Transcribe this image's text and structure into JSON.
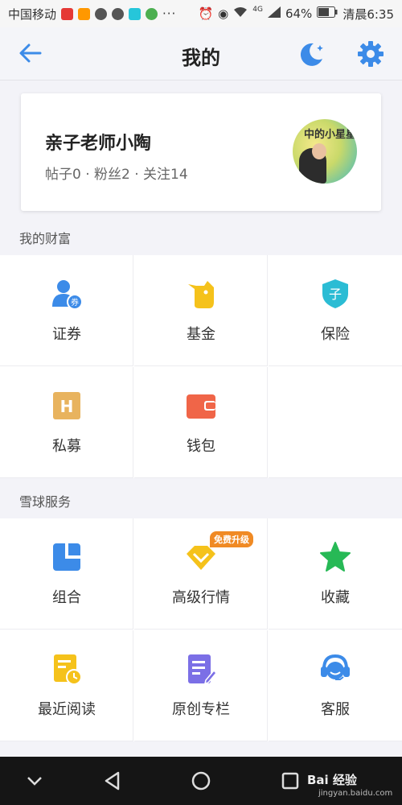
{
  "status_bar": {
    "carrier": "中国移动",
    "battery": "64%",
    "time": "清晨6:35",
    "dots": "···",
    "signal_label": "4G"
  },
  "header": {
    "title": "我的"
  },
  "profile": {
    "name": "亲子老师小陶",
    "stats": "帖子0 · 粉丝2 · 关注14",
    "avatar_text": "中的小星星"
  },
  "wealth": {
    "title": "我的财富",
    "items": [
      {
        "label": "证券",
        "icon": "user-coupon-icon",
        "badge_glyph": "券"
      },
      {
        "label": "基金",
        "icon": "fund-icon"
      },
      {
        "label": "保险",
        "icon": "insurance-shield-icon",
        "glyph": "子"
      },
      {
        "label": "私募",
        "icon": "private-fund-icon",
        "glyph": "H"
      },
      {
        "label": "钱包",
        "icon": "wallet-icon"
      }
    ]
  },
  "services": {
    "title": "雪球服务",
    "items": [
      {
        "label": "组合",
        "icon": "portfolio-icon"
      },
      {
        "label": "高级行情",
        "icon": "advanced-quotes-icon",
        "badge": "免费升级"
      },
      {
        "label": "收藏",
        "icon": "star-icon"
      },
      {
        "label": "最近阅读",
        "icon": "recent-reading-icon"
      },
      {
        "label": "原创专栏",
        "icon": "column-edit-icon"
      },
      {
        "label": "客服",
        "icon": "customer-service-icon"
      }
    ]
  },
  "navbar": {
    "watermark": "Bai 经验",
    "watermark_sub": "jingyan.baidu.com"
  },
  "colors": {
    "accent_blue": "#3c8be8",
    "yellow": "#f5c21b",
    "teal": "#2bbcd4",
    "orange_red": "#f06548",
    "green": "#27b956",
    "purple": "#7b6fe6",
    "badge_orange": "#f08a24"
  }
}
